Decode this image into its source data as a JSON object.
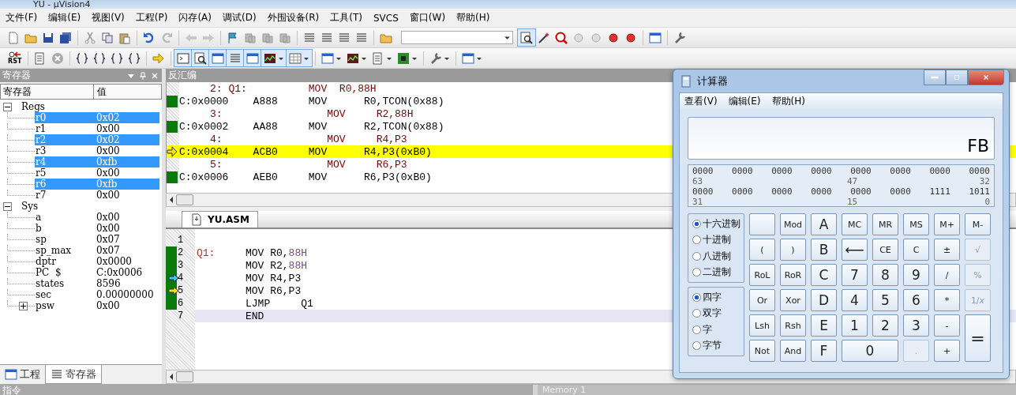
{
  "window": {
    "title": "YU - µVision4"
  },
  "menu": [
    "文件(F)",
    "编辑(E)",
    "视图(V)",
    "工程(P)",
    "闪存(A)",
    "调试(D)",
    "外围设备(R)",
    "工具(T)",
    "SVCS",
    "窗口(W)",
    "帮助(H)"
  ],
  "toolbar": {
    "reset_label": "RST"
  },
  "registers": {
    "title": "寄存器",
    "columns": [
      "寄存器",
      "值"
    ],
    "groups": [
      {
        "name": "Regs",
        "expanded": true,
        "children": [
          {
            "name": "r0",
            "value": "0x02",
            "changed": true
          },
          {
            "name": "r1",
            "value": "0x00",
            "changed": false
          },
          {
            "name": "r2",
            "value": "0x02",
            "changed": true
          },
          {
            "name": "r3",
            "value": "0x00",
            "changed": false
          },
          {
            "name": "r4",
            "value": "0xfb",
            "changed": true
          },
          {
            "name": "r5",
            "value": "0x00",
            "changed": false
          },
          {
            "name": "r6",
            "value": "0xfb",
            "changed": true
          },
          {
            "name": "r7",
            "value": "0x00",
            "changed": false
          }
        ]
      },
      {
        "name": "Sys",
        "expanded": true,
        "children": [
          {
            "name": "a",
            "value": "0x00",
            "changed": false
          },
          {
            "name": "b",
            "value": "0x00",
            "changed": false
          },
          {
            "name": "sp",
            "value": "0x07",
            "changed": false
          },
          {
            "name": "sp_max",
            "value": "0x07",
            "changed": false
          },
          {
            "name": "dptr",
            "value": "0x0000",
            "changed": false
          },
          {
            "name": "PC  $",
            "value": "C:0x0006",
            "changed": false
          },
          {
            "name": "states",
            "value": "8596",
            "changed": false
          },
          {
            "name": "sec",
            "value": "0.00000000",
            "changed": false
          },
          {
            "name": "psw",
            "value": "0x00",
            "changed": false,
            "expanded": false
          }
        ]
      }
    ],
    "tabs": [
      {
        "label": "工程",
        "selected": false
      },
      {
        "label": "寄存器",
        "selected": true
      }
    ]
  },
  "disassembly": {
    "title": "反汇编",
    "lines": [
      {
        "kind": "source",
        "text": "2: Q1:          MOV  R0,88H",
        "current": false
      },
      {
        "kind": "asm",
        "address": "C:0x0000",
        "opcode": "A888",
        "mnemonic": "MOV",
        "operands": "R0,TCON(0x88)",
        "current": false
      },
      {
        "kind": "source",
        "text": "3:                 MOV     R2,88H",
        "current": false
      },
      {
        "kind": "asm",
        "address": "C:0x0002",
        "opcode": "AA88",
        "mnemonic": "MOV",
        "operands": "R2,TCON(0x88)",
        "current": false
      },
      {
        "kind": "source",
        "text": "4:                 MOV     R4,P3",
        "current": false
      },
      {
        "kind": "asm",
        "address": "C:0x0004",
        "opcode": "ACB0",
        "mnemonic": "MOV",
        "operands": "R4,P3(0xB0)",
        "current": true
      },
      {
        "kind": "source",
        "text": "5:                 MOV     R6,P3",
        "current": false
      },
      {
        "kind": "asm",
        "address": "C:0x0006",
        "opcode": "AEB0",
        "mnemonic": "MOV",
        "operands": "R6,P3(0xB0)",
        "current": false
      }
    ]
  },
  "editor": {
    "tab": "YU.ASM",
    "lines": [
      {
        "number": "1",
        "executed": false,
        "cursor": false,
        "current": false,
        "highlighted": false
      },
      {
        "number": "2",
        "label": "Q1:",
        "code": "MOV R0,",
        "literal": "88H",
        "executed": true,
        "cursor": false,
        "current": false,
        "highlighted": false
      },
      {
        "number": "3",
        "code": "MOV R2,",
        "literal": "88H",
        "executed": true,
        "cursor": false,
        "current": false,
        "highlighted": false
      },
      {
        "number": "4",
        "code": "MOV R4,P3",
        "executed": true,
        "cursor": true,
        "current": false,
        "highlighted": false
      },
      {
        "number": "5",
        "code": "MOV R6,P3",
        "executed": true,
        "cursor": false,
        "current": true,
        "highlighted": false
      },
      {
        "number": "6",
        "code": "LJMP     Q1",
        "executed": true,
        "cursor": false,
        "current": false,
        "highlighted": false
      },
      {
        "number": "7",
        "code": "END",
        "executed": false,
        "cursor": false,
        "current": false,
        "highlighted": true
      }
    ]
  },
  "bottom": {
    "left_title": "指令",
    "right_title": "Memory 1"
  },
  "calculator": {
    "title": "计算器",
    "menu": [
      "查看(V)",
      "编辑(E)",
      "帮助(H)"
    ],
    "display": "FB",
    "bits": [
      {
        "groups": [
          "0000",
          "0000",
          "0000",
          "0000",
          "0000",
          "0000",
          "0000",
          "0000"
        ],
        "labels": [
          "63",
          "47",
          "32"
        ]
      },
      {
        "groups": [
          "0000",
          "0000",
          "0000",
          "0000",
          "0000",
          "0000",
          "1111",
          "1011"
        ],
        "labels": [
          "31",
          "15",
          "0"
        ]
      }
    ],
    "bases": [
      {
        "label": "十六进制",
        "selected": true
      },
      {
        "label": "十进制",
        "selected": false
      },
      {
        "label": "八进制",
        "selected": false
      },
      {
        "label": "二进制",
        "selected": false
      }
    ],
    "sizes": [
      {
        "label": "四字",
        "selected": true
      },
      {
        "label": "双字",
        "selected": false
      },
      {
        "label": "字",
        "selected": false
      },
      {
        "label": "字节",
        "selected": false
      }
    ],
    "keys": [
      {
        "kind": "blank",
        "disabled": false
      },
      {
        "kind": "key",
        "label": "Mod",
        "disabled": false
      },
      {
        "kind": "digit",
        "label": "A",
        "disabled": false
      },
      {
        "kind": "key",
        "label": "MC",
        "disabled": false
      },
      {
        "kind": "key",
        "label": "MR",
        "disabled": false
      },
      {
        "kind": "key",
        "label": "MS",
        "disabled": false
      },
      {
        "kind": "key",
        "label": "M+",
        "disabled": false
      },
      {
        "kind": "key",
        "label": "M-",
        "disabled": false
      },
      {
        "kind": "key",
        "label": "(",
        "disabled": false
      },
      {
        "kind": "key",
        "label": ")",
        "disabled": false
      },
      {
        "kind": "digit",
        "label": "B",
        "disabled": false
      },
      {
        "kind": "digit",
        "label": "⟵",
        "disabled": false
      },
      {
        "kind": "key",
        "label": "CE",
        "disabled": false
      },
      {
        "kind": "key",
        "label": "C",
        "disabled": false
      },
      {
        "kind": "key",
        "label": "±",
        "disabled": false
      },
      {
        "kind": "key",
        "label": "√",
        "disabled": true
      },
      {
        "kind": "key",
        "label": "RoL",
        "disabled": false
      },
      {
        "kind": "key",
        "label": "RoR",
        "disabled": false
      },
      {
        "kind": "digit",
        "label": "C",
        "disabled": false
      },
      {
        "kind": "digit",
        "label": "7",
        "disabled": false
      },
      {
        "kind": "digit",
        "label": "8",
        "disabled": false
      },
      {
        "kind": "digit",
        "label": "9",
        "disabled": false
      },
      {
        "kind": "key",
        "label": "/",
        "disabled": false
      },
      {
        "kind": "key",
        "label": "%",
        "disabled": true
      },
      {
        "kind": "key",
        "label": "Or",
        "disabled": false
      },
      {
        "kind": "key",
        "label": "Xor",
        "disabled": false
      },
      {
        "kind": "digit",
        "label": "D",
        "disabled": false
      },
      {
        "kind": "digit",
        "label": "4",
        "disabled": false
      },
      {
        "kind": "digit",
        "label": "5",
        "disabled": false
      },
      {
        "kind": "digit",
        "label": "6",
        "disabled": false
      },
      {
        "kind": "key",
        "label": "*",
        "disabled": false
      },
      {
        "kind": "key",
        "label": "1/*x*",
        "disabled": true
      },
      {
        "kind": "key",
        "label": "Lsh",
        "disabled": false
      },
      {
        "kind": "key",
        "label": "Rsh",
        "disabled": false
      },
      {
        "kind": "digit",
        "label": "E",
        "disabled": false
      },
      {
        "kind": "digit",
        "label": "1",
        "disabled": false
      },
      {
        "kind": "digit",
        "label": "2",
        "disabled": false
      },
      {
        "kind": "digit",
        "label": "3",
        "disabled": false
      },
      {
        "kind": "key",
        "label": "-",
        "disabled": false
      },
      {
        "kind": "tall",
        "label": "=",
        "disabled": false
      },
      {
        "kind": "key",
        "label": "Not",
        "disabled": false
      },
      {
        "kind": "key",
        "label": "And",
        "disabled": false
      },
      {
        "kind": "digit",
        "label": "F",
        "disabled": false
      },
      {
        "kind": "wide",
        "label": "0",
        "disabled": false
      },
      {
        "kind": "key",
        "label": ".",
        "disabled": true
      },
      {
        "kind": "key",
        "label": "+",
        "disabled": false
      }
    ]
  }
}
